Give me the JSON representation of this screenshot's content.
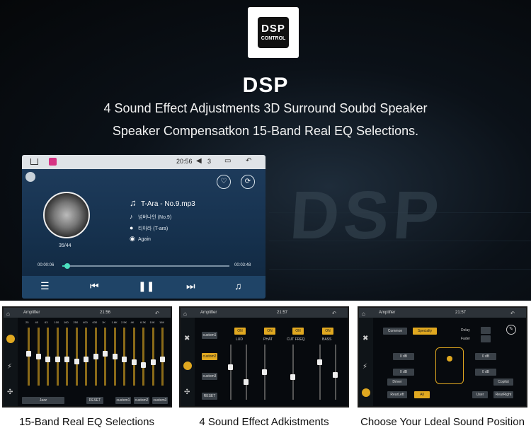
{
  "hero": {
    "logo_top": "DSP",
    "logo_bottom": "CONTROL",
    "title": "DSP",
    "subtitle_line1": "4 Sound Effect Adjustments 3D Surround Soubd Speaker",
    "subtitle_line2": "Speaker Compensatkon 15-Band Real EQ Selections.",
    "watermark": "DSP"
  },
  "player": {
    "status_time": "20:56",
    "volume": "3",
    "song": "T-Ara - No.9.mp3",
    "album": "넘버나인 (No.9)",
    "artist": "티아라 (T-ara)",
    "mode": "Again",
    "track_index": "35/44",
    "elapsed": "00:00:06",
    "total": "00:03:48",
    "progress": 0.03
  },
  "panel_eq": {
    "title": "Amplifier",
    "time": "21:56",
    "freqs": [
      "25",
      "40",
      "63",
      "100",
      "160",
      "250",
      "400",
      "630",
      "1K",
      "1.6K",
      "2.5K",
      "4K",
      "6.3K",
      "10K",
      "16K"
    ],
    "levels": [
      0.55,
      0.5,
      0.45,
      0.45,
      0.45,
      0.42,
      0.45,
      0.5,
      0.55,
      0.5,
      0.45,
      0.4,
      0.35,
      0.4,
      0.45
    ],
    "preset": "Jazz",
    "reset": "RESET",
    "custom1": "custom1",
    "custom2": "custom2",
    "custom3": "custom3"
  },
  "panel_sound": {
    "title": "Amplifier",
    "time": "21:57",
    "custom1": "custom1",
    "custom2": "custom2",
    "custom3": "custom3",
    "reset": "RESET",
    "columns": [
      "LUD",
      "PHAT",
      "CUT FREQ",
      "BASS"
    ],
    "on": "ON"
  },
  "panel_pos": {
    "title": "Amplifier",
    "time": "21:57",
    "common": "Common",
    "specialty": "Specialty",
    "delay": "Delay",
    "fader": "Fader",
    "db": "0 dB",
    "driver": "Driver",
    "copilot": "Copilot",
    "rearleft": "RearLeft",
    "all": "All",
    "user": "User",
    "rearright": "RearRight"
  },
  "captions": {
    "c1": "15-Band Real EQ Selections",
    "c2": "4 Sound Effect Adkistments",
    "c3": "Choose Your Ldeal Sound Position"
  }
}
